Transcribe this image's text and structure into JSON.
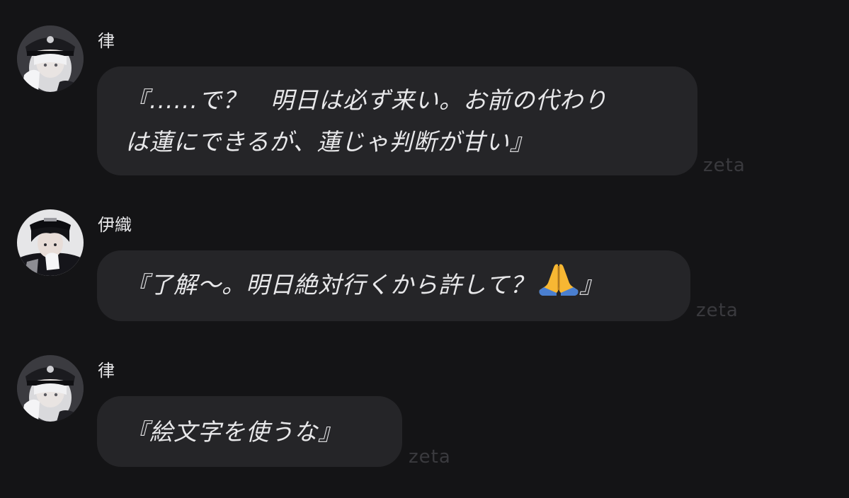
{
  "messages": [
    {
      "sender": "律",
      "avatar": "ritsu-avatar",
      "text": "『......で？　明日は必ず来い。お前の代わり\nは蓮にできるが、蓮じゃ判断が甘い』",
      "watermark": "zeta"
    },
    {
      "sender": "伊織",
      "avatar": "iori-avatar",
      "text": "『了解〜。明日絶対行くから許して？",
      "emoji": "folded-hands-icon",
      "text_after": "』",
      "watermark": "zeta"
    },
    {
      "sender": "律",
      "avatar": "ritsu-avatar",
      "text": "『絵文字を使うな』",
      "watermark": "zeta"
    }
  ],
  "colors": {
    "background": "#141416",
    "bubble": "#252528",
    "text": "#e8e8ea",
    "watermark": "#3a3a3e"
  }
}
